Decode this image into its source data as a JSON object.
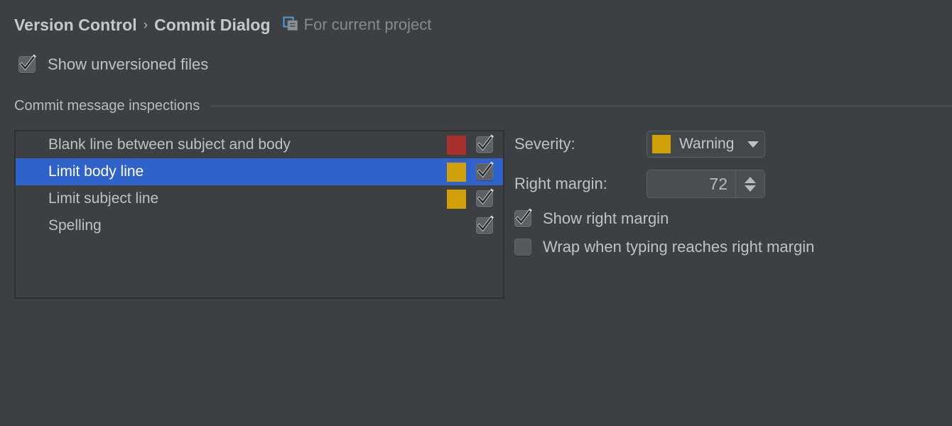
{
  "header": {
    "breadcrumb": [
      {
        "label": "Version Control"
      },
      {
        "label": "Commit Dialog"
      }
    ],
    "separator": "›",
    "scope_icon": "copy-project-icon",
    "scope_label": "For current project"
  },
  "options_top": {
    "show_unversioned": {
      "label": "Show unversioned files",
      "checked": true
    }
  },
  "section": {
    "title": "Commit message inspections"
  },
  "inspections": {
    "rows": [
      {
        "name": "Blank line between subject and body",
        "severity_color": "#a8312e",
        "enabled": true,
        "selected": false
      },
      {
        "name": "Limit body line",
        "severity_color": "#cfa009",
        "enabled": true,
        "selected": true
      },
      {
        "name": "Limit subject line",
        "severity_color": "#cfa009",
        "enabled": true,
        "selected": false
      },
      {
        "name": "Spelling",
        "severity_color": "",
        "enabled": true,
        "selected": false
      }
    ]
  },
  "settings": {
    "severity": {
      "label": "Severity:",
      "value": "Warning",
      "swatch_color": "#cfa009",
      "options": [
        "Warning"
      ]
    },
    "right_margin": {
      "label": "Right margin:",
      "value": "72"
    },
    "show_right_margin": {
      "label": "Show right margin",
      "checked": true
    },
    "wrap_on_margin": {
      "label": "Wrap when typing reaches right margin",
      "checked": false
    }
  },
  "colors": {
    "background": "#3c4043",
    "selection": "#2f63c9",
    "error_red": "#a8312e",
    "warning_gold": "#cfa009",
    "text": "#bfc2c4",
    "text_muted": "#858a8d"
  }
}
